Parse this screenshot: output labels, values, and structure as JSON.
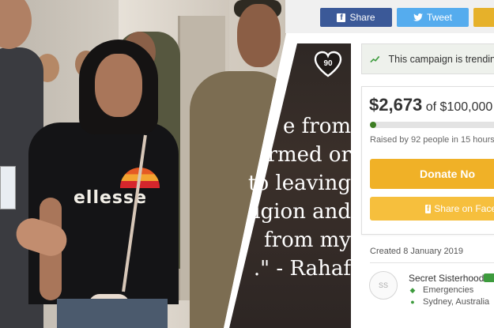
{
  "share_bar": {
    "facebook_label": "Share",
    "twitter_label": "Tweet"
  },
  "quote": {
    "lines": [
      "e from",
      "rmed or",
      "to leaving",
      "igion and",
      "from my",
      ".\" - Rahaf"
    ],
    "likes": "90"
  },
  "campaign": {
    "trending_text": "This campaign is trendin",
    "amount_raised": "$2,673",
    "amount_of": "of",
    "amount_goal": "$100,000",
    "progress_fraction": 0.027,
    "raised_by": "Raised by 92 people in 15 hours",
    "donate_label": "Donate No",
    "facebook_share_label": "Share on Face",
    "created": "Created 8 January 2019",
    "organizer": {
      "avatar_initials": "SS",
      "name": "Secret Sisterhood",
      "category": "Emergencies",
      "location": "Sydney, Australia"
    }
  },
  "colors": {
    "facebook": "#3b5998",
    "twitter": "#55acee",
    "donate": "#f0b127",
    "progress": "#3d7e23"
  },
  "icons": [
    "facebook-icon",
    "twitter-icon",
    "heart-icon",
    "trending-icon",
    "tag-icon",
    "location-pin-icon",
    "verified-icon"
  ]
}
